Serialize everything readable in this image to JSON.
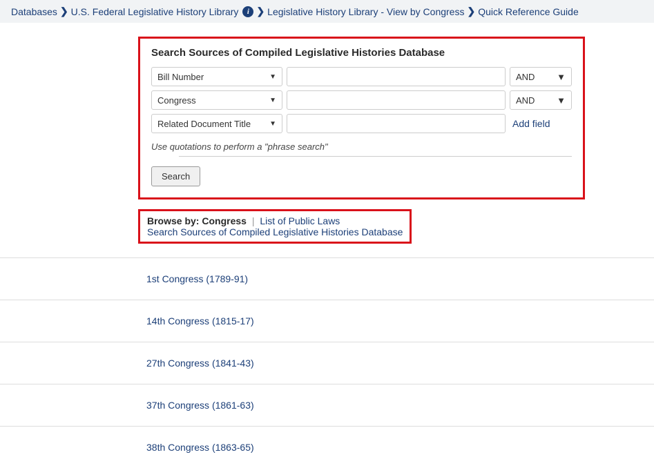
{
  "breadcrumb": {
    "items": [
      {
        "label": "Databases"
      },
      {
        "label": "U.S. Federal Legislative History Library",
        "has_info": true
      },
      {
        "label": "Legislative History Library - View by Congress"
      },
      {
        "label": "Quick Reference Guide"
      }
    ]
  },
  "search": {
    "title": "Search Sources of Compiled Legislative Histories Database",
    "rows": [
      {
        "field": "Bill Number",
        "value": "",
        "operator": "AND"
      },
      {
        "field": "Congress",
        "value": "",
        "operator": "AND"
      },
      {
        "field": "Related Document Title",
        "value": ""
      }
    ],
    "add_field": "Add field",
    "hint": "Use quotations to perform a \"phrase search\"",
    "button": "Search"
  },
  "browse": {
    "label": "Browse by:",
    "current": "Congress",
    "alt": "List of Public Laws",
    "link": "Search Sources of Compiled Legislative Histories Database"
  },
  "congresses": [
    "1st Congress (1789-91)",
    "14th Congress (1815-17)",
    "27th Congress (1841-43)",
    "37th Congress (1861-63)",
    "38th Congress (1863-65)"
  ]
}
